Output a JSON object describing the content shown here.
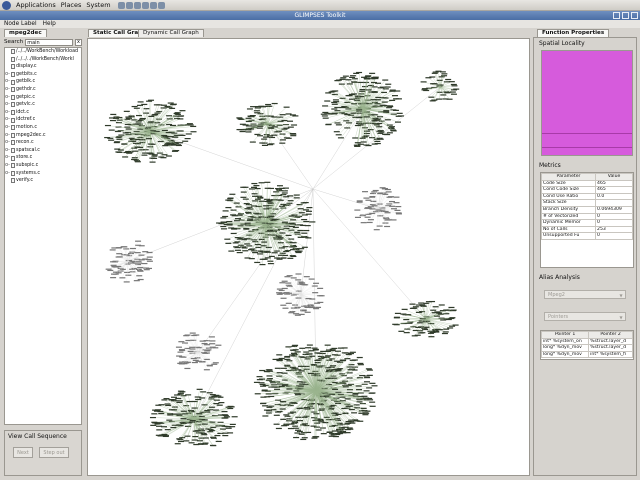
{
  "system_panel": {
    "menus": [
      "Applications",
      "Places",
      "System"
    ]
  },
  "window": {
    "title": "GLIMPSES Toolkit"
  },
  "menubar": {
    "items": [
      "Node Label",
      "Help"
    ]
  },
  "left_panel": {
    "tab": "mpeg2dec",
    "search_label": "Search",
    "search_value": "main",
    "clear_label": "x",
    "tree": [
      {
        "toggle": "",
        "label": "/../../WorkBench/Workload"
      },
      {
        "toggle": "",
        "label": "/../../../WorkBench/Workl"
      },
      {
        "toggle": "",
        "label": "display.c"
      },
      {
        "toggle": "o-",
        "label": "getbits.c"
      },
      {
        "toggle": "o-",
        "label": "getblk.c"
      },
      {
        "toggle": "o-",
        "label": "gethdr.c"
      },
      {
        "toggle": "o-",
        "label": "getpic.c"
      },
      {
        "toggle": "o-",
        "label": "getvlc.c"
      },
      {
        "toggle": "o-",
        "label": "idct.c"
      },
      {
        "toggle": "o-",
        "label": "idctref.c"
      },
      {
        "toggle": "o-",
        "label": "motion.c"
      },
      {
        "toggle": "o-",
        "label": "mpeg2dec.c"
      },
      {
        "toggle": "o-",
        "label": "recon.c"
      },
      {
        "toggle": "o-",
        "label": "spatscal.c"
      },
      {
        "toggle": "o-",
        "label": "store.c"
      },
      {
        "toggle": "o-",
        "label": "subspic.c"
      },
      {
        "toggle": "o-",
        "label": "systems.c"
      },
      {
        "toggle": "",
        "label": "verify.c"
      }
    ],
    "call_sequence_title": "View Call Sequence",
    "next_label": "Next",
    "step_out_label": "Step out"
  },
  "center_panel": {
    "tabs": [
      "Static Call Graph",
      "Dynamic Call Graph"
    ]
  },
  "right_panel": {
    "tab": "Function Properties",
    "spatial_title": "Spatial Locality",
    "spatial_color": "#d65bdc",
    "metrics_title": "Metrics",
    "metrics_headers": [
      "Parameter",
      "Value"
    ],
    "metrics": [
      [
        "Code Size",
        "465"
      ],
      [
        "Cond Code Size",
        "465"
      ],
      [
        "Cond Use Ratio",
        "0.0"
      ],
      [
        "Stack Size",
        ""
      ],
      [
        "Branch Density",
        "0.0694309"
      ],
      [
        "# of Vectorized",
        "0"
      ],
      [
        "Dynamic Memor",
        "0"
      ],
      [
        "No of Calls",
        "253"
      ],
      [
        "Unsupported Fu",
        "0"
      ]
    ],
    "alias_title": "Alias Analysis",
    "combo1": "Mpeg2",
    "combo2": "Pointers",
    "alias_headers": [
      "Pointer 1",
      "Pointer 2"
    ],
    "alias_rows": [
      [
        "int* %system_on",
        "%struct.layer_d"
      ],
      [
        "long* %dyn_mov",
        "%struct.layer_d"
      ],
      [
        "long* %dyn_mov",
        "int* %system_fi"
      ]
    ]
  }
}
